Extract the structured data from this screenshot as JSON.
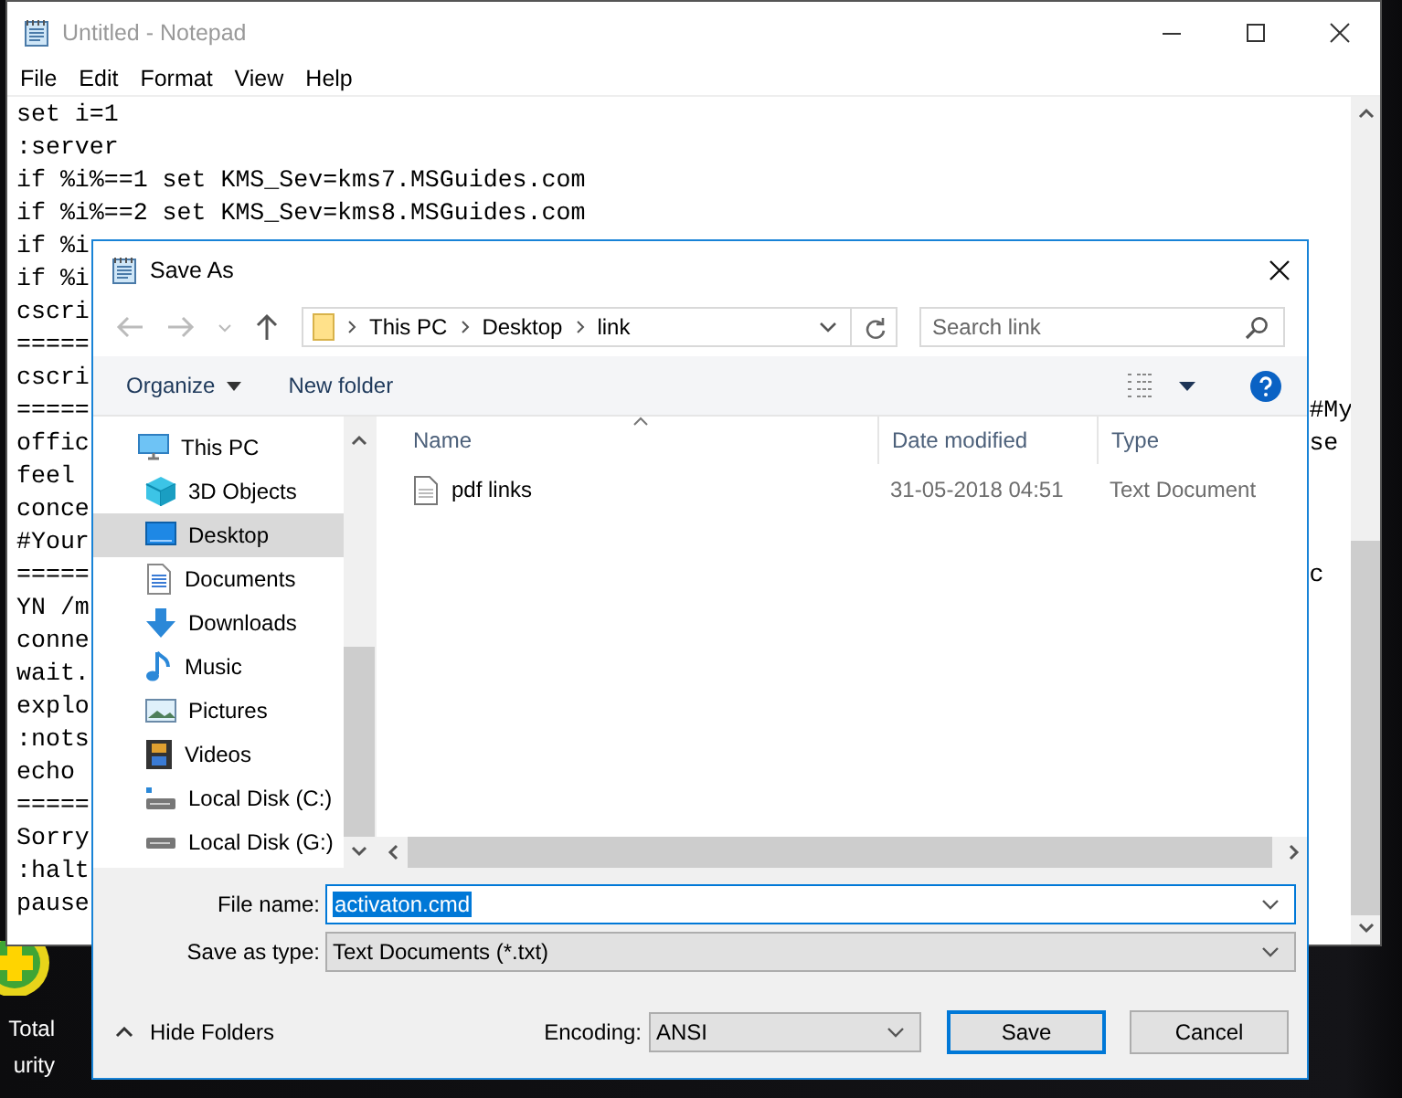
{
  "desktop": {
    "icon_label_lines": [
      "Total",
      "urity"
    ]
  },
  "notepad": {
    "title": "Untitled - Notepad",
    "menu": [
      "File",
      "Edit",
      "Format",
      "View",
      "Help"
    ],
    "lines": [
      {
        "text": "set i=1"
      },
      {
        "text": ":server"
      },
      {
        "text": "if %i%==1 set KMS_Sev=kms7.MSGuides.com"
      },
      {
        "text": "if %i%==2 set KMS_Sev=kms8.MSGuides.com"
      },
      {
        "text": "if %i"
      },
      {
        "text": "if %i"
      },
      {
        "text": "cscri"
      },
      {
        "text": "====="
      },
      {
        "text": "cscri"
      },
      {
        "text": "=====",
        "right": "#My"
      },
      {
        "text": "offic",
        "right": "se"
      },
      {
        "text": "feel"
      },
      {
        "text": "conce"
      },
      {
        "text": "#Your"
      },
      {
        "text": "=====",
        "right": "c"
      },
      {
        "text": "YN /m"
      },
      {
        "text": "conne"
      },
      {
        "text": "wait."
      },
      {
        "text": "explo"
      },
      {
        "text": ":nots"
      },
      {
        "text": "echo"
      },
      {
        "text": "====="
      },
      {
        "text": "Sorry"
      },
      {
        "text": ":halt"
      },
      {
        "text": "pause"
      }
    ]
  },
  "save_dialog": {
    "title": "Save As",
    "breadcrumb": [
      "This PC",
      "Desktop",
      "link"
    ],
    "search": {
      "placeholder": "Search link"
    },
    "organize": "Organize",
    "new_folder": "New folder",
    "nav": [
      {
        "label": "This PC",
        "kind": "pc",
        "selected": false,
        "children": [
          {
            "label": "3D Objects",
            "kind": "cube",
            "selected": false
          },
          {
            "label": "Desktop",
            "kind": "desktop",
            "selected": true
          },
          {
            "label": "Documents",
            "kind": "documents",
            "selected": false
          },
          {
            "label": "Downloads",
            "kind": "downloads",
            "selected": false
          },
          {
            "label": "Music",
            "kind": "music",
            "selected": false
          },
          {
            "label": "Pictures",
            "kind": "pictures",
            "selected": false
          },
          {
            "label": "Videos",
            "kind": "videos",
            "selected": false
          },
          {
            "label": "Local Disk (C:)",
            "kind": "system-disk",
            "selected": false
          },
          {
            "label": "Local Disk (G:)",
            "kind": "disk",
            "selected": false
          }
        ]
      }
    ],
    "columns": [
      "Name",
      "Date modified",
      "Type"
    ],
    "files": [
      {
        "name": "pdf links",
        "date": "31-05-2018 04:51",
        "type": "Text Document"
      }
    ],
    "file_name_label": "File name:",
    "file_name": "activaton.cmd",
    "type_label": "Save as type:",
    "type_value": "Text Documents (*.txt)",
    "hide_folders": "Hide Folders",
    "encoding_label": "Encoding:",
    "encoding": "ANSI",
    "buttons": [
      {
        "label": "Save",
        "kind": "default"
      },
      {
        "label": "Cancel",
        "kind": "normal"
      }
    ]
  }
}
